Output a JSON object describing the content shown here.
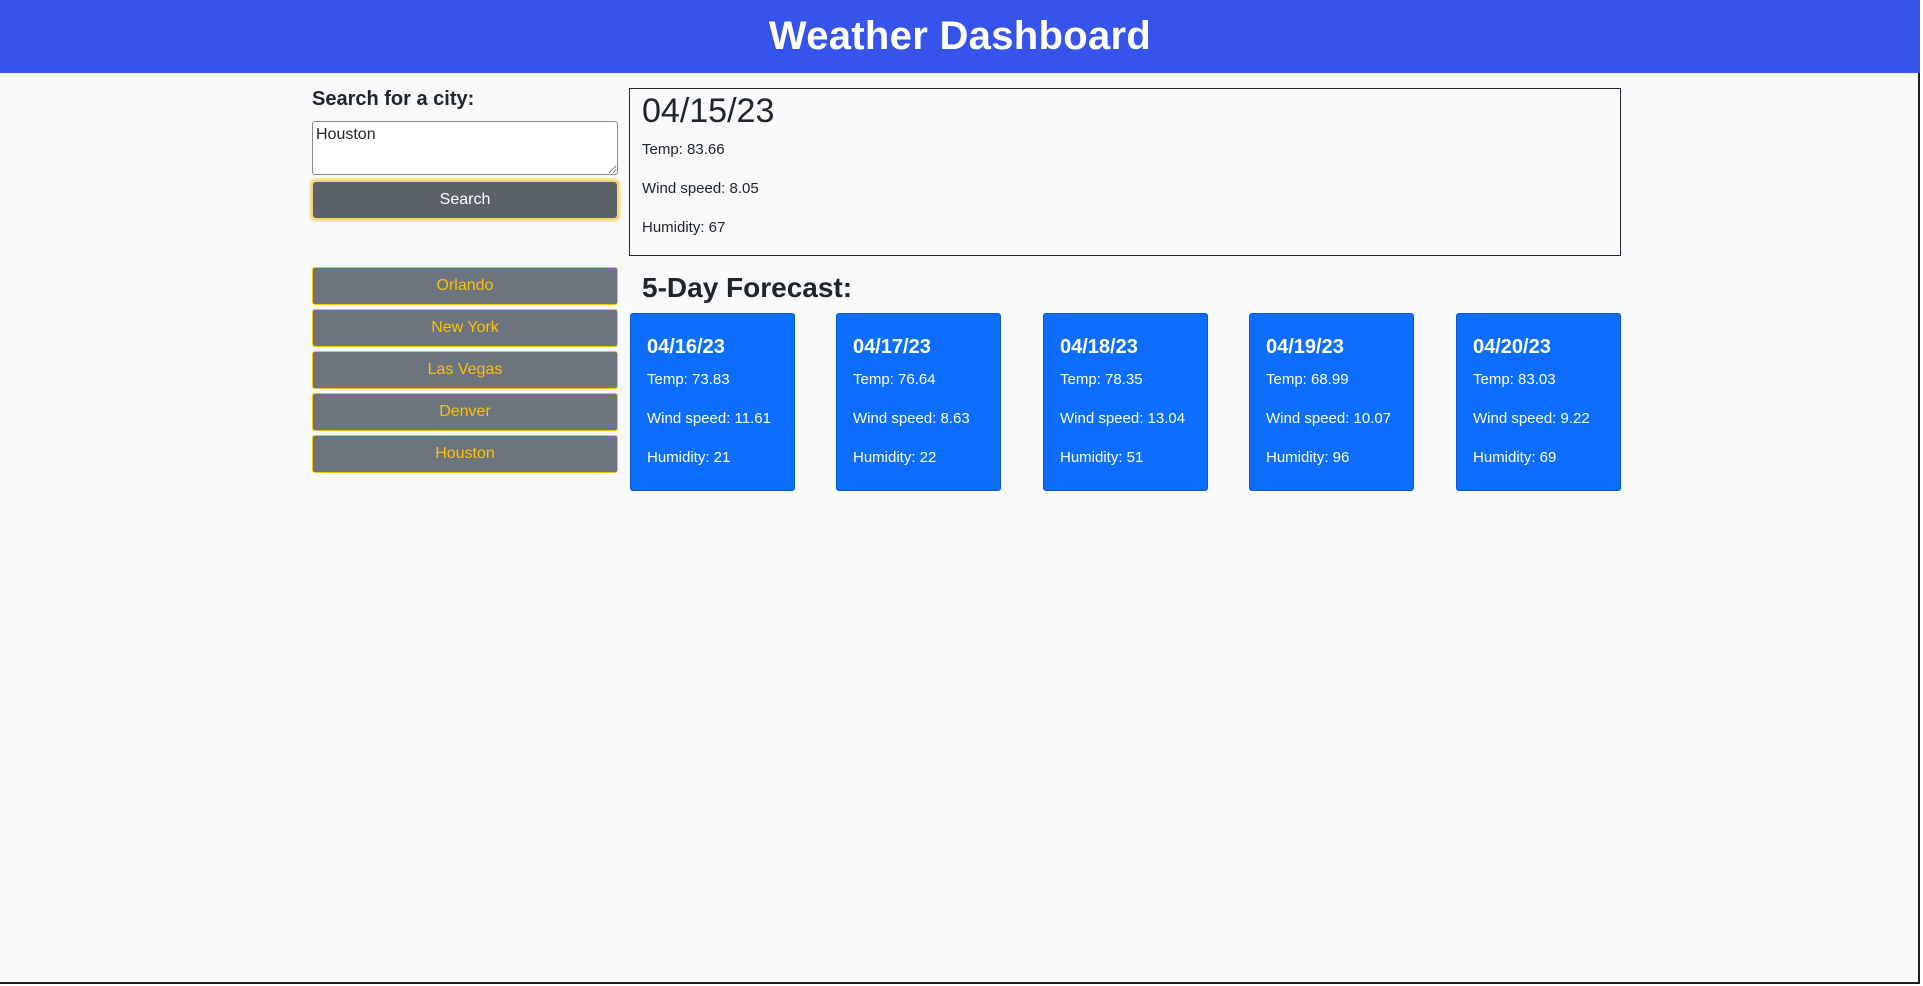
{
  "header": {
    "title": "Weather Dashboard"
  },
  "search": {
    "label": "Search for a city:",
    "input_value": "Houston",
    "button_label": "Search"
  },
  "history": [
    {
      "label": "Orlando"
    },
    {
      "label": "New York"
    },
    {
      "label": "Las Vegas"
    },
    {
      "label": "Denver"
    },
    {
      "label": "Houston"
    }
  ],
  "current": {
    "date": "04/15/23",
    "temp": "Temp: 83.66",
    "wind": "Wind speed: 8.05",
    "humidity": "Humidity: 67"
  },
  "forecast": {
    "title": "5-Day Forecast:",
    "days": [
      {
        "date": "04/16/23",
        "temp": "Temp: 73.83",
        "wind": "Wind speed: 11.61",
        "humidity": "Humidity: 21"
      },
      {
        "date": "04/17/23",
        "temp": "Temp: 76.64",
        "wind": "Wind speed: 8.63",
        "humidity": "Humidity: 22"
      },
      {
        "date": "04/18/23",
        "temp": "Temp: 78.35",
        "wind": "Wind speed: 13.04",
        "humidity": "Humidity: 51"
      },
      {
        "date": "04/19/23",
        "temp": "Temp: 68.99",
        "wind": "Wind speed: 10.07",
        "humidity": "Humidity: 96"
      },
      {
        "date": "04/20/23",
        "temp": "Temp: 83.03",
        "wind": "Wind speed: 9.22",
        "humidity": "Humidity: 69"
      }
    ]
  },
  "colors": {
    "header": "#3653ec",
    "forecast_card": "#0d6efd",
    "history_button": "#6c757d",
    "history_text": "#ffc107",
    "search_button": "#5a6169"
  }
}
